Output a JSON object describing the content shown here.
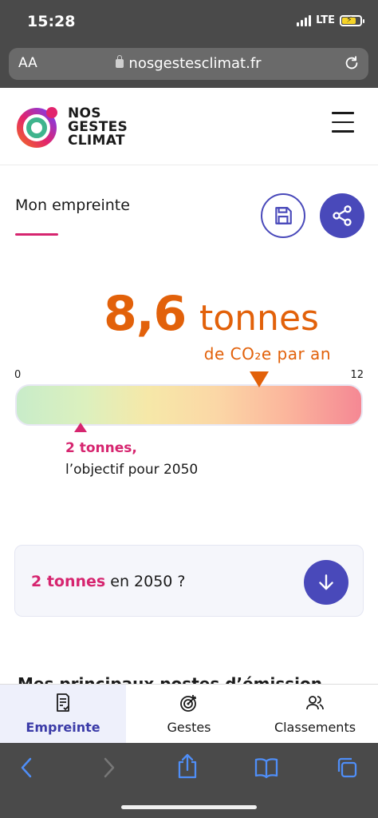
{
  "status_bar": {
    "time": "15:28",
    "network": "LTE"
  },
  "browser": {
    "aa_label": "AA",
    "url": "nosgestesclimat.fr"
  },
  "site": {
    "logo_lines": [
      "NOS",
      "GESTES",
      "CLIMAT"
    ]
  },
  "section": {
    "title": "Mon empreinte"
  },
  "footprint": {
    "value": "8,6",
    "unit": "tonnes",
    "sub_unit": "de CO₂e par an",
    "numeric_value": 8.6
  },
  "gauge": {
    "min_label": "0",
    "max_label": "12",
    "min": 0,
    "max": 12,
    "target_value": 2,
    "goal_value": "2 tonnes,",
    "goal_label": "l’objectif pour 2050"
  },
  "card": {
    "highlight": "2 tonnes",
    "rest": " en 2050 ?"
  },
  "peek_text": "Mes principaux postes d’émission",
  "tabs": [
    {
      "label": "Empreinte",
      "icon": "document-check-icon",
      "active": true
    },
    {
      "label": "Gestes",
      "icon": "target-icon",
      "active": false
    },
    {
      "label": "Classements",
      "icon": "users-icon",
      "active": false
    }
  ],
  "colors": {
    "accent": "#4949ba",
    "footprint": "#e2610a",
    "target": "#d6256f"
  }
}
